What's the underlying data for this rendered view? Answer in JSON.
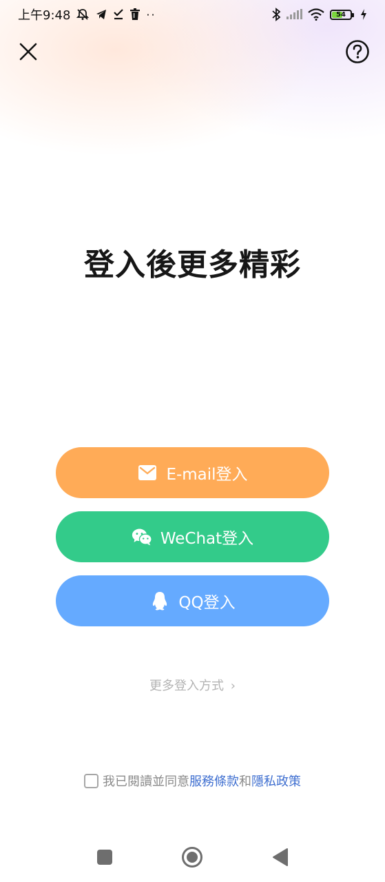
{
  "status_bar": {
    "time": "上午9:48",
    "battery_level": "54",
    "icons_left": [
      "notification-off-icon",
      "telegram-icon",
      "check-icon",
      "trash-icon",
      "more-dots-icon"
    ],
    "icons_right": [
      "bluetooth-icon",
      "signal-icon",
      "wifi-icon",
      "battery-icon",
      "charging-icon"
    ]
  },
  "header": {
    "close_icon": "close-icon",
    "help_icon": "help-icon"
  },
  "main": {
    "title": "登入後更多精彩"
  },
  "login_buttons": [
    {
      "label": "E-mail登入",
      "icon": "mail-icon",
      "color": "#ffab57"
    },
    {
      "label": "WeChat登入",
      "icon": "wechat-icon",
      "color": "#33cb8a"
    },
    {
      "label": "QQ登入",
      "icon": "qq-icon",
      "color": "#65aaff"
    }
  ],
  "more_login": {
    "label": "更多登入方式",
    "chevron": "›"
  },
  "agreement": {
    "text": "我已閱讀並同意",
    "terms_link": "服務條款",
    "and": "和",
    "privacy_link": "隱私政策",
    "checked": false,
    "link_color": "#3f6fd0"
  },
  "nav_bar": {
    "items": [
      "recent-apps-button",
      "home-button",
      "back-button"
    ]
  }
}
